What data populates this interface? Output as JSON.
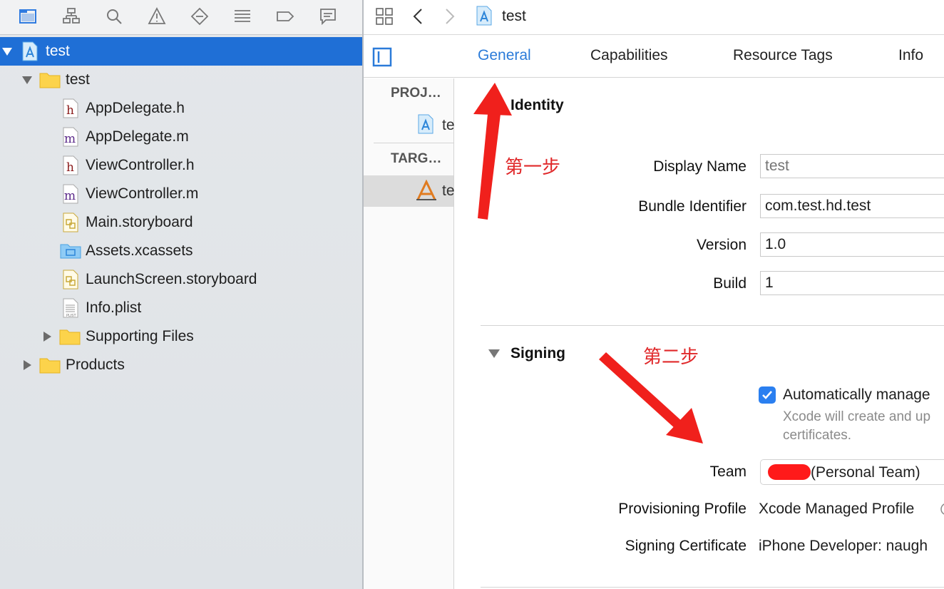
{
  "navigator": {
    "toolbar_icons": [
      "folder-icon",
      "hierarchy-icon",
      "search-icon",
      "warning-icon",
      "breakpoint-diamond-icon",
      "list-icon",
      "tag-icon",
      "comment-icon"
    ],
    "tree": [
      {
        "label": "test",
        "icon": "xcode-project-icon",
        "expanded": true,
        "selected": true
      },
      {
        "label": "test",
        "icon": "folder-icon",
        "expanded": true
      },
      {
        "label": "AppDelegate.h",
        "icon": "header-file-icon"
      },
      {
        "label": "AppDelegate.m",
        "icon": "objc-file-icon"
      },
      {
        "label": "ViewController.h",
        "icon": "header-file-icon"
      },
      {
        "label": "ViewController.m",
        "icon": "objc-file-icon"
      },
      {
        "label": "Main.storyboard",
        "icon": "storyboard-icon"
      },
      {
        "label": "Assets.xcassets",
        "icon": "asset-catalog-icon"
      },
      {
        "label": "LaunchScreen.storyboard",
        "icon": "storyboard-icon"
      },
      {
        "label": "Info.plist",
        "icon": "plist-icon"
      },
      {
        "label": "Supporting Files",
        "icon": "folder-icon",
        "expanded": false
      },
      {
        "label": "Products",
        "icon": "folder-icon",
        "expanded": false
      }
    ]
  },
  "editor": {
    "jump_bar": {
      "title": "test"
    },
    "tabs": [
      "General",
      "Capabilities",
      "Resource Tags",
      "Info"
    ],
    "active_tab": "General",
    "targets_list": {
      "project_header": "PROJ…",
      "project_item": "te",
      "targets_header": "TARG…",
      "target_item": "te"
    },
    "identity": {
      "title": "Identity",
      "display_name_label": "Display Name",
      "display_name_placeholder": "test",
      "bundle_id_label": "Bundle Identifier",
      "bundle_id_value": "com.test.hd.test",
      "version_label": "Version",
      "version_value": "1.0",
      "build_label": "Build",
      "build_value": "1"
    },
    "signing": {
      "title": "Signing",
      "auto_manage_label": "Automatically manage",
      "auto_manage_checked": true,
      "auto_manage_note_line1": "Xcode will create and up",
      "auto_manage_note_line2": "certificates.",
      "team_label": "Team",
      "team_value": "(Personal Team)",
      "provisioning_label": "Provisioning Profile",
      "provisioning_value": "Xcode Managed Profile",
      "certificate_label": "Signing Certificate",
      "certificate_value": "iPhone Developer: naugh"
    }
  },
  "annotations": {
    "step1": "第一步",
    "step2": "第二步"
  },
  "colors": {
    "selection": "#1f6fd6",
    "accent": "#2b7bd9",
    "annotation": "#e0282a",
    "checkbox": "#2a7ff0"
  }
}
